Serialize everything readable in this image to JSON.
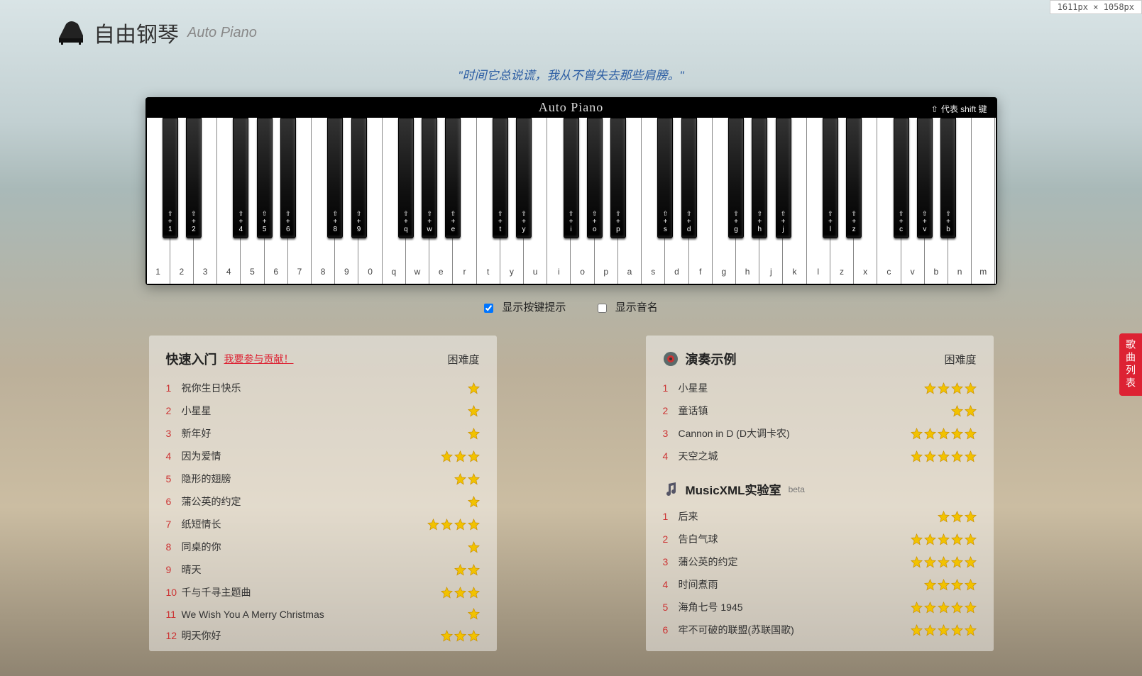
{
  "badge": "1611px × 1058px",
  "header": {
    "title_zh": "自由钢琴",
    "title_en": "Auto Piano"
  },
  "quote": "\"时间它总说谎，我从不曾失去那些肩膀。\"",
  "piano": {
    "brand": "Auto Piano",
    "shift_hint_prefix": "⇧",
    "shift_hint": "代表 shift 键",
    "white_labels": [
      "1",
      "2",
      "3",
      "4",
      "5",
      "6",
      "7",
      "8",
      "9",
      "0",
      "q",
      "w",
      "e",
      "r",
      "t",
      "y",
      "u",
      "i",
      "o",
      "p",
      "a",
      "s",
      "d",
      "f",
      "g",
      "h",
      "j",
      "k",
      "l",
      "z",
      "x",
      "c",
      "v",
      "b",
      "n",
      "m"
    ],
    "black_map": {
      "0": "1",
      "1": "2",
      "3": "4",
      "4": "5",
      "5": "6",
      "7": "8",
      "8": "9",
      "10": "q",
      "11": "w",
      "12": "e",
      "14": "t",
      "15": "y",
      "17": "i",
      "18": "o",
      "19": "p",
      "21": "s",
      "22": "d",
      "24": "g",
      "25": "h",
      "26": "j",
      "28": "l",
      "29": "z",
      "31": "c",
      "32": "v",
      "33": "b"
    }
  },
  "options": {
    "show_keys": {
      "label": "显示按键提示",
      "checked": true
    },
    "show_notes": {
      "label": "显示音名",
      "checked": false
    }
  },
  "side_tab": "歌曲列表",
  "left_panel": {
    "title": "快速入门",
    "contribute": "我要参与贡献！",
    "difficulty": "困难度",
    "songs": [
      {
        "n": "1",
        "name": "祝你生日快乐",
        "stars": 1
      },
      {
        "n": "2",
        "name": "小星星",
        "stars": 1
      },
      {
        "n": "3",
        "name": "新年好",
        "stars": 1
      },
      {
        "n": "4",
        "name": "因为爱情",
        "stars": 3
      },
      {
        "n": "5",
        "name": "隐形的翅膀",
        "stars": 2
      },
      {
        "n": "6",
        "name": "蒲公英的约定",
        "stars": 1
      },
      {
        "n": "7",
        "name": "纸短情长",
        "stars": 4
      },
      {
        "n": "8",
        "name": "同桌的你",
        "stars": 1
      },
      {
        "n": "9",
        "name": "晴天",
        "stars": 2
      },
      {
        "n": "10",
        "name": "千与千寻主题曲",
        "stars": 3
      },
      {
        "n": "11",
        "name": "We Wish You A Merry Christmas",
        "stars": 1
      },
      {
        "n": "12",
        "name": "明天你好",
        "stars": 3
      }
    ]
  },
  "right_panel": {
    "title": "演奏示例",
    "difficulty": "困难度",
    "songs": [
      {
        "n": "1",
        "name": "小星星",
        "stars": 4
      },
      {
        "n": "2",
        "name": "童话镇",
        "stars": 2
      },
      {
        "n": "3",
        "name": "Cannon in D (D大调卡农)",
        "stars": 5
      },
      {
        "n": "4",
        "name": "天空之城",
        "stars": 5
      }
    ],
    "sub_title": "MusicXML实验室",
    "sub_beta": "beta",
    "sub_songs": [
      {
        "n": "1",
        "name": "后来",
        "stars": 3
      },
      {
        "n": "2",
        "name": "告白气球",
        "stars": 5
      },
      {
        "n": "3",
        "name": "蒲公英的约定",
        "stars": 5
      },
      {
        "n": "4",
        "name": "时间煮雨",
        "stars": 4
      },
      {
        "n": "5",
        "name": "海角七号 1945",
        "stars": 5
      },
      {
        "n": "6",
        "name": "牢不可破的联盟(苏联国歌)",
        "stars": 5
      }
    ]
  }
}
